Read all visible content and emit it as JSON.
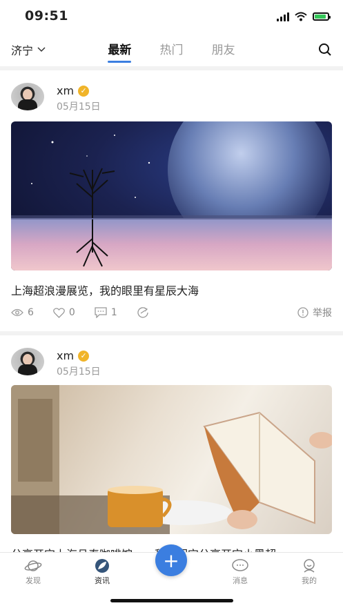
{
  "status": {
    "time": "09:51"
  },
  "header": {
    "city": "济宁",
    "tabs": [
      {
        "label": "最新",
        "active": true
      },
      {
        "label": "热门",
        "active": false
      },
      {
        "label": "朋友",
        "active": false
      }
    ]
  },
  "posts": [
    {
      "username": "xm",
      "date": "05月15日",
      "title": "上海超浪漫展览，我的眼里有星辰大海",
      "views": "6",
      "likes": "0",
      "comments": "1",
      "report_label": "举报"
    },
    {
      "username": "xm",
      "date": "05月15日",
      "title_partial": "分享开宝上海且泰咖啡馆……甜美明宝分享开宝小黑超"
    }
  ],
  "tabbar": {
    "items": [
      {
        "label": "发现",
        "icon": "planet-icon"
      },
      {
        "label": "资讯",
        "icon": "leaf-icon",
        "active": true
      },
      {
        "label": "消息",
        "icon": "chat-icon"
      },
      {
        "label": "我的",
        "icon": "profile-icon"
      }
    ],
    "add_label": "+"
  },
  "colors": {
    "accent": "#3b7ee0",
    "verify": "#f0b429",
    "battery": "#35c759"
  }
}
